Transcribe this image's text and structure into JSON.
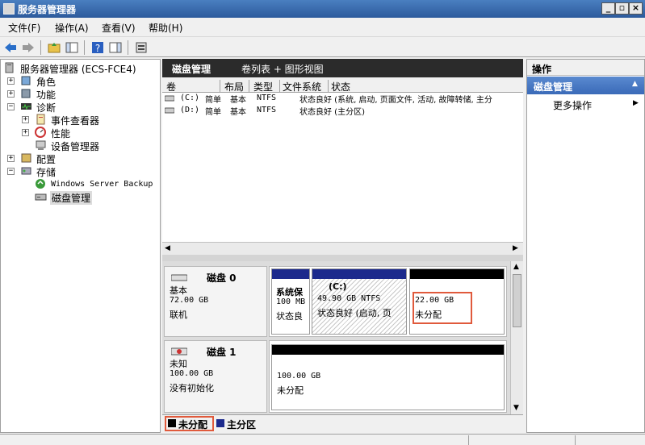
{
  "window": {
    "title": "服务器管理器"
  },
  "menu": [
    "文件(F)",
    "操作(A)",
    "查看(V)",
    "帮助(H)"
  ],
  "tree": {
    "root": "服务器管理器 (ECS-FCE4)",
    "items": [
      {
        "label": "角色"
      },
      {
        "label": "功能"
      },
      {
        "label": "诊断"
      },
      {
        "label": "事件查看器"
      },
      {
        "label": "性能"
      },
      {
        "label": "设备管理器"
      },
      {
        "label": "配置"
      },
      {
        "label": "存储"
      },
      {
        "label": "Windows Server Backup"
      },
      {
        "label": "磁盘管理"
      }
    ]
  },
  "middle": {
    "title": "磁盘管理",
    "view": "卷列表 + 图形视图",
    "columns": [
      "卷",
      "布局",
      "类型",
      "文件系统",
      "状态"
    ],
    "volumes": [
      {
        "vol": "(C:)",
        "layout": "简单",
        "type": "基本",
        "fs": "NTFS",
        "status": "状态良好 (系统, 启动, 页面文件, 活动, 故障转储, 主分"
      },
      {
        "vol": "(D:)",
        "layout": "简单",
        "type": "基本",
        "fs": "NTFS",
        "status": "状态良好 (主分区)"
      }
    ]
  },
  "disks": [
    {
      "name": "磁盘 0",
      "type": "基本",
      "size": "72.00 GB",
      "state": "联机",
      "partitions": [
        {
          "title": "系统保",
          "line2": "100 MB",
          "line3": "状态良",
          "color": "#1c2a8c"
        },
        {
          "title": "(C:)",
          "line2": "49.90 GB NTFS",
          "line3": "状态良好 (启动, 页",
          "color": "#1c2a8c"
        },
        {
          "title": "",
          "line2": "22.00 GB",
          "line3": "未分配",
          "color": "#000000"
        }
      ]
    },
    {
      "name": "磁盘 1",
      "type": "未知",
      "size": "100.00 GB",
      "state": "没有初始化",
      "partitions": [
        {
          "line2": "100.00 GB",
          "line3": "未分配",
          "color": "#000000"
        }
      ]
    }
  ],
  "legend": [
    {
      "label": "未分配",
      "color": "#000000"
    },
    {
      "label": "主分区",
      "color": "#1c2a8c"
    }
  ],
  "actions": {
    "header": "操作",
    "section": "磁盘管理",
    "more": "更多操作"
  }
}
